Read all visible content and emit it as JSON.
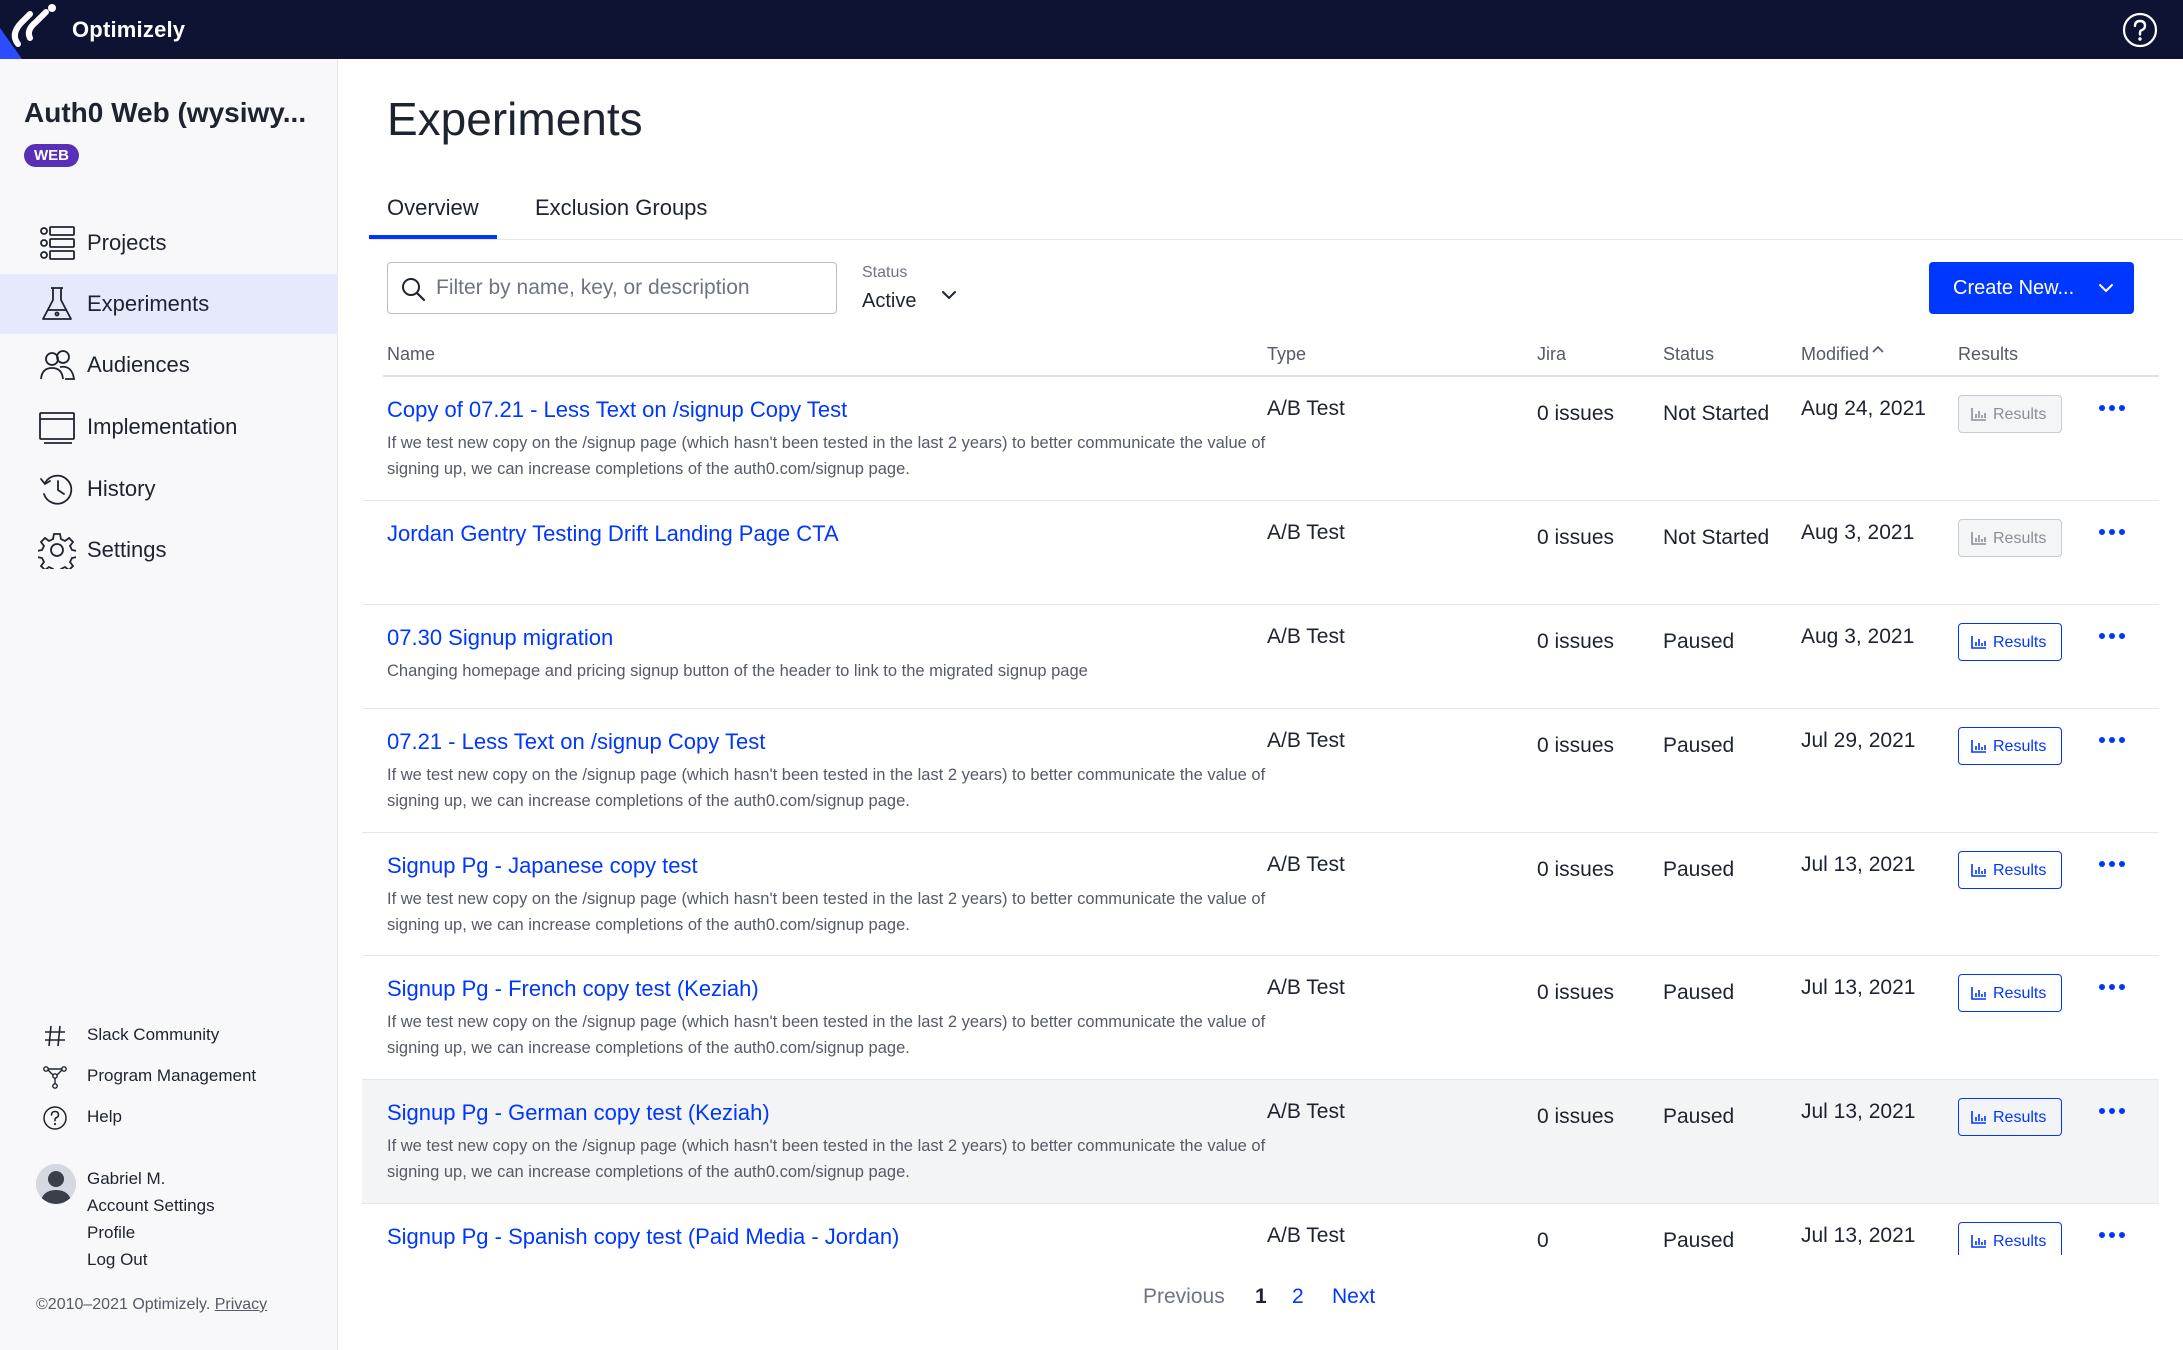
{
  "app": {
    "brand": "Optimizely"
  },
  "sidebar": {
    "project_name": "Auth0 Web (wysiwy...",
    "badge": "WEB",
    "nav": [
      {
        "label": "Projects",
        "icon": "projects-icon"
      },
      {
        "label": "Experiments",
        "icon": "flask-icon",
        "active": true
      },
      {
        "label": "Audiences",
        "icon": "audiences-icon"
      },
      {
        "label": "Implementation",
        "icon": "implementation-icon"
      },
      {
        "label": "History",
        "icon": "history-icon"
      },
      {
        "label": "Settings",
        "icon": "gear-icon"
      }
    ],
    "footer_links": [
      {
        "label": "Slack Community",
        "icon": "hash-icon"
      },
      {
        "label": "Program Management",
        "icon": "network-icon"
      },
      {
        "label": "Help",
        "icon": "help-icon"
      }
    ],
    "user": {
      "name": "Gabriel M.",
      "account_settings": "Account Settings",
      "profile": "Profile",
      "logout": "Log Out"
    },
    "copyright": "©2010–2021 Optimizely.",
    "privacy": "Privacy"
  },
  "main": {
    "title": "Experiments",
    "tabs": [
      {
        "label": "Overview",
        "active": true
      },
      {
        "label": "Exclusion Groups",
        "active": false
      }
    ],
    "search": {
      "placeholder": "Filter by name, key, or description",
      "value": ""
    },
    "status_filter": {
      "label": "Status",
      "value": "Active"
    },
    "create_button": "Create New...",
    "columns": {
      "name": "Name",
      "type": "Type",
      "jira": "Jira",
      "status": "Status",
      "modified": "Modified",
      "results": "Results"
    },
    "sort": {
      "column": "Modified",
      "direction": "ascending-caret"
    },
    "rows": [
      {
        "name": "Copy of 07.21 - Less Text on /signup Copy Test",
        "description": "If we test new copy on the /signup page (which hasn't been tested in the last 2 years) to better communicate the value of signing up, we can increase completions of the auth0.com/signup page.",
        "type": "A/B Test",
        "jira": "0 issues",
        "status": "Not Started",
        "modified": "Aug 24, 2021",
        "results": "Results",
        "results_enabled": false
      },
      {
        "name": "Jordan Gentry Testing Drift Landing Page CTA",
        "description": "",
        "type": "A/B Test",
        "jira": "0 issues",
        "status": "Not Started",
        "modified": "Aug 3, 2021",
        "results": "Results",
        "results_enabled": false
      },
      {
        "name": "07.30 Signup migration",
        "description": "Changing homepage and pricing signup button of the header to link to the migrated signup page",
        "type": "A/B Test",
        "jira": "0 issues",
        "status": "Paused",
        "modified": "Aug 3, 2021",
        "results": "Results",
        "results_enabled": true
      },
      {
        "name": "07.21 - Less Text on /signup Copy Test",
        "description": "If we test new copy on the /signup page (which hasn't been tested in the last 2 years) to better communicate the value of signing up, we can increase completions of the auth0.com/signup page.",
        "type": "A/B Test",
        "jira": "0 issues",
        "status": "Paused",
        "modified": "Jul 29, 2021",
        "results": "Results",
        "results_enabled": true
      },
      {
        "name": "Signup Pg - Japanese copy test",
        "description": "If we test new copy on the /signup page (which hasn't been tested in the last 2 years) to better communicate the value of signing up, we can increase completions of the auth0.com/signup page.",
        "type": "A/B Test",
        "jira": "0 issues",
        "status": "Paused",
        "modified": "Jul 13, 2021",
        "results": "Results",
        "results_enabled": true
      },
      {
        "name": "Signup Pg - French copy test (Keziah)",
        "description": "If we test new copy on the /signup page (which hasn't been tested in the last 2 years) to better communicate the value of signing up, we can increase completions of the auth0.com/signup page.",
        "type": "A/B Test",
        "jira": "0 issues",
        "status": "Paused",
        "modified": "Jul 13, 2021",
        "results": "Results",
        "results_enabled": true
      },
      {
        "name": "Signup Pg - German copy test (Keziah)",
        "description": "If we test new copy on the /signup page (which hasn't been tested in the last 2 years) to better communicate the value of signing up, we can increase completions of the auth0.com/signup page.",
        "type": "A/B Test",
        "jira": "0 issues",
        "status": "Paused",
        "modified": "Jul 13, 2021",
        "results": "Results",
        "results_enabled": true,
        "hovered": true
      },
      {
        "name": "Signup Pg - Spanish copy test (Paid Media - Jordan)",
        "description": "",
        "type": "A/B Test",
        "jira": "0",
        "status": "Paused",
        "modified": "Jul 13, 2021",
        "results": "Results",
        "results_enabled": true
      }
    ],
    "pagination": {
      "previous": "Previous",
      "pages": [
        "1",
        "2"
      ],
      "current": "1",
      "next": "Next"
    }
  },
  "colors": {
    "topbar": "#0e1233",
    "accent": "#0037ff",
    "badge": "#5a2fb8",
    "active_nav": "#e5e9fb"
  }
}
